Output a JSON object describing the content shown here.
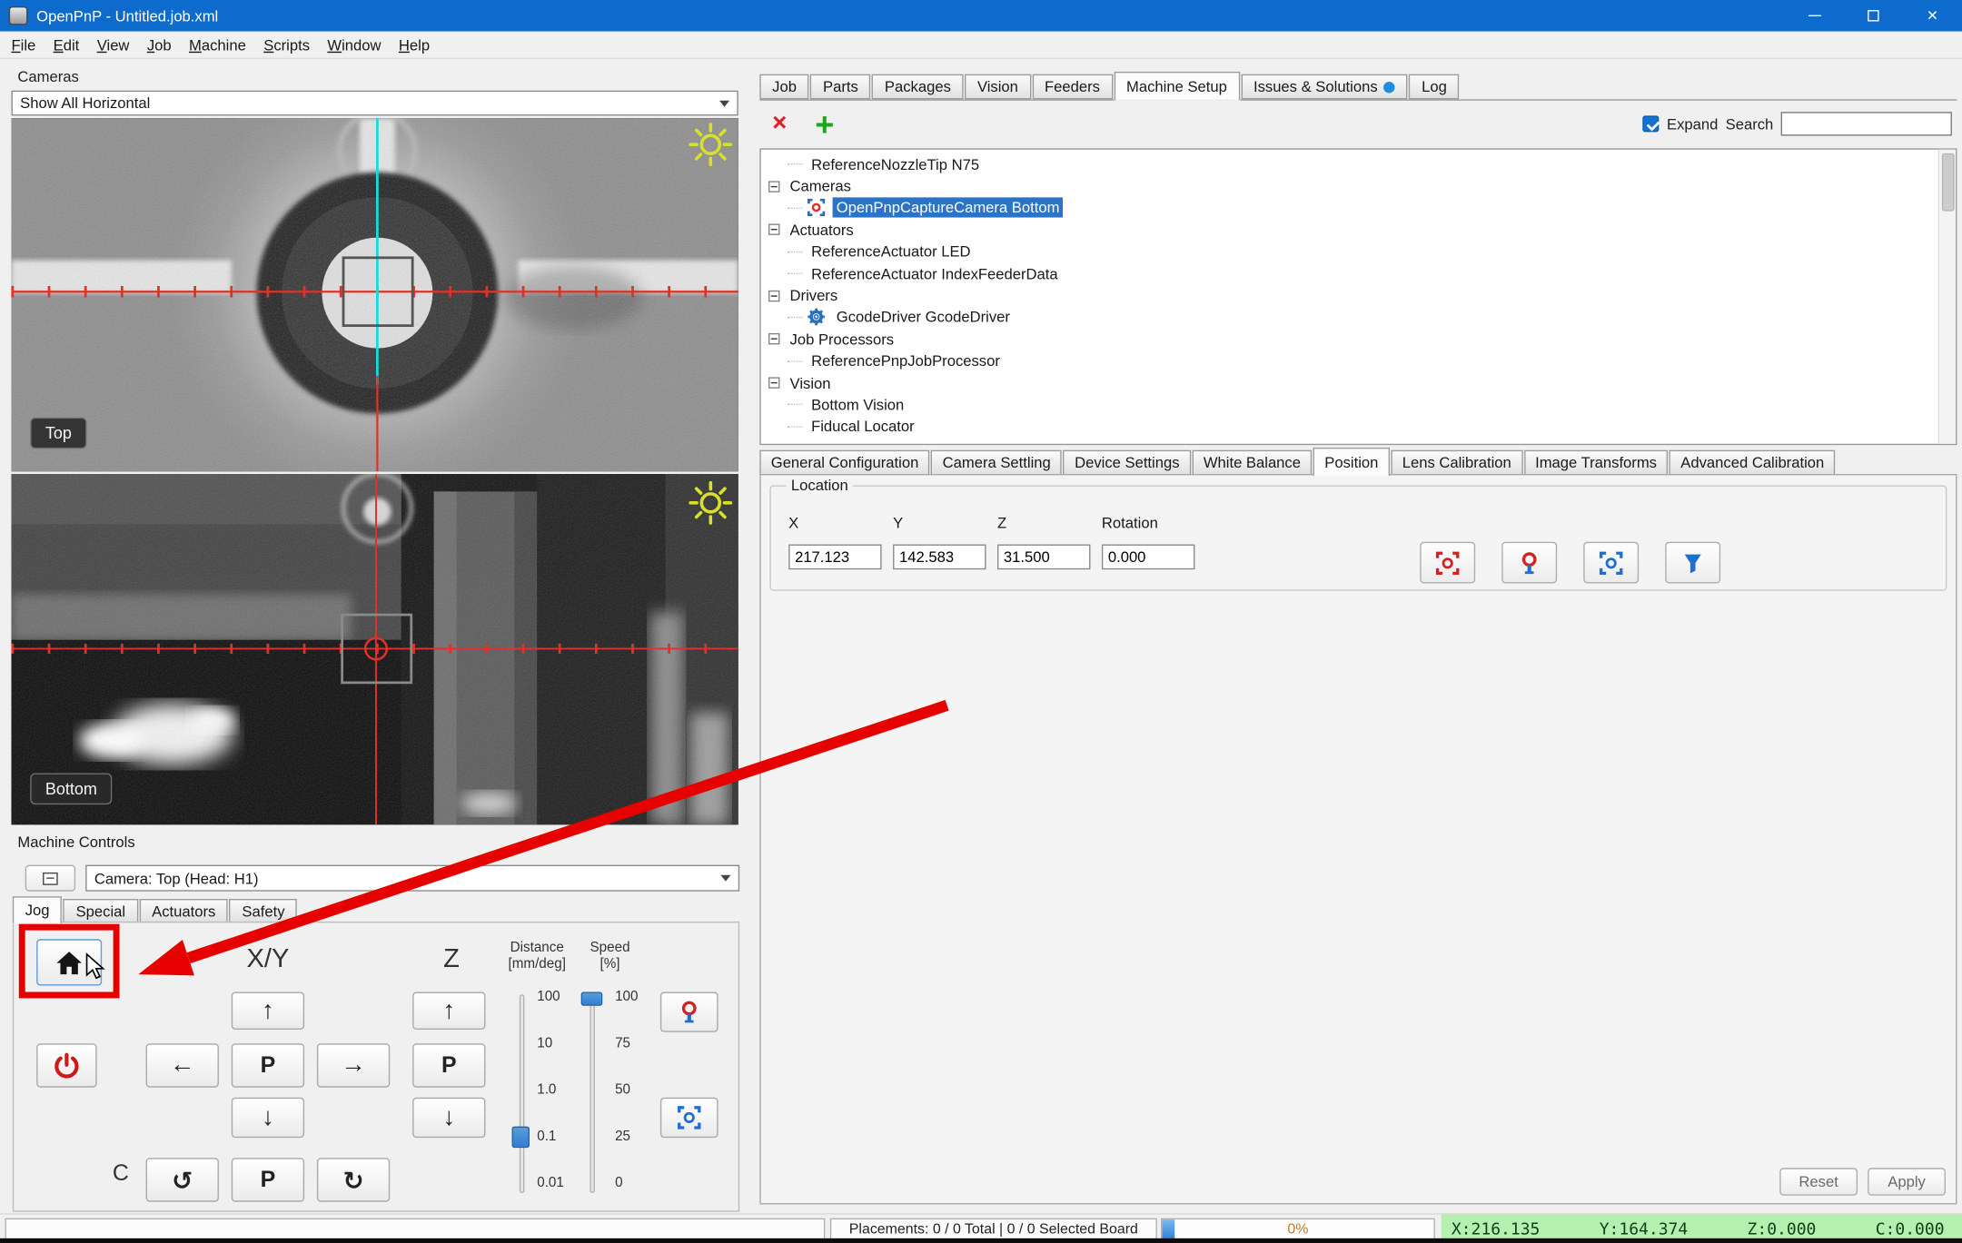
{
  "window": {
    "title": "OpenPnP - Untitled.job.xml",
    "close_glyph": "×"
  },
  "menu": {
    "items": [
      "File",
      "Edit",
      "View",
      "Job",
      "Machine",
      "Scripts",
      "Window",
      "Help"
    ]
  },
  "cameras": {
    "panel_title": "Cameras",
    "view_selector": "Show All Horizontal",
    "top_badge": "Top",
    "bottom_badge": "Bottom"
  },
  "machine_controls": {
    "panel_title": "Machine Controls",
    "camera_selector": "Camera: Top (Head: H1)",
    "tabs": [
      {
        "label": "Jog",
        "active": true
      },
      {
        "label": "Special"
      },
      {
        "label": "Actuators"
      },
      {
        "label": "Safety"
      }
    ],
    "xy_label": "X/Y",
    "z_label": "Z",
    "c_label": "C",
    "p_label": "P",
    "arrows": {
      "up": "↑",
      "down": "↓",
      "left": "←",
      "right": "→",
      "ccw": "↺",
      "cw": "↻"
    },
    "distance": {
      "title": "Distance",
      "unit": "[mm/deg]",
      "ticks": [
        "100",
        "10",
        "1.0",
        "0.1",
        "0.01"
      ]
    },
    "speed": {
      "title": "Speed",
      "unit": "[%]",
      "ticks": [
        "100",
        "75",
        "50",
        "25",
        "0"
      ]
    }
  },
  "main_tabs": [
    {
      "label": "Job"
    },
    {
      "label": "Parts"
    },
    {
      "label": "Packages"
    },
    {
      "label": "Vision"
    },
    {
      "label": "Feeders"
    },
    {
      "label": "Machine Setup",
      "active": true
    },
    {
      "label": "Issues & Solutions",
      "badge": true
    },
    {
      "label": "Log"
    }
  ],
  "setup_toolbar": {
    "delete_glyph": "×",
    "add_glyph": "+",
    "expand_label": "Expand",
    "expand_checked": true,
    "search_label": "Search",
    "search_value": ""
  },
  "tree": {
    "items": [
      {
        "label": "ReferenceNozzleTip N75",
        "depth": 1,
        "type": "leaf"
      },
      {
        "label": "Cameras",
        "depth": 0,
        "type": "branch"
      },
      {
        "label": "OpenPnpCaptureCamera Bottom",
        "depth": 1,
        "type": "leaf",
        "icon": "camera",
        "selected": true
      },
      {
        "label": "Actuators",
        "depth": 0,
        "type": "branch"
      },
      {
        "label": "ReferenceActuator LED",
        "depth": 1,
        "type": "leaf"
      },
      {
        "label": "ReferenceActuator IndexFeederData",
        "depth": 1,
        "type": "leaf"
      },
      {
        "label": "Drivers",
        "depth": 0,
        "type": "branch"
      },
      {
        "label": "GcodeDriver GcodeDriver",
        "depth": 1,
        "type": "leaf",
        "icon": "gear"
      },
      {
        "label": "Job Processors",
        "depth": 0,
        "type": "branch"
      },
      {
        "label": "ReferencePnpJobProcessor",
        "depth": 1,
        "type": "leaf"
      },
      {
        "label": "Vision",
        "depth": 0,
        "type": "branch"
      },
      {
        "label": "Bottom Vision",
        "depth": 1,
        "type": "leaf"
      },
      {
        "label": "Fiducal Locator",
        "depth": 1,
        "type": "leaf"
      }
    ]
  },
  "config_tabs": [
    {
      "label": "General Configuration"
    },
    {
      "label": "Camera Settling"
    },
    {
      "label": "Device Settings"
    },
    {
      "label": "White Balance"
    },
    {
      "label": "Position",
      "active": true
    },
    {
      "label": "Lens Calibration"
    },
    {
      "label": "Image Transforms"
    },
    {
      "label": "Advanced Calibration"
    }
  ],
  "position_panel": {
    "group_title": "Location",
    "fields": [
      {
        "label": "X",
        "value": "217.123"
      },
      {
        "label": "Y",
        "value": "142.583"
      },
      {
        "label": "Z",
        "value": "31.500"
      },
      {
        "label": "Rotation",
        "value": "0.000"
      }
    ],
    "reset_label": "Reset",
    "apply_label": "Apply"
  },
  "status_bar": {
    "placements": "Placements: 0 / 0 Total | 0 / 0 Selected Board",
    "progress_text": "0%",
    "dro": {
      "x": "X:216.135",
      "y": "Y:164.374",
      "z": "Z:0.000",
      "c": "C:0.000"
    }
  },
  "colors": {
    "titlebar_blue": "#0d6bce",
    "selection_blue": "#2a73c7",
    "issues_badge_blue": "#1e8fe0",
    "dro_green_bg": "#b4f0af",
    "annotation_red": "#e60000",
    "progress_text_orange": "#c07820",
    "delete_red": "#e02020",
    "add_green": "#18a818"
  }
}
